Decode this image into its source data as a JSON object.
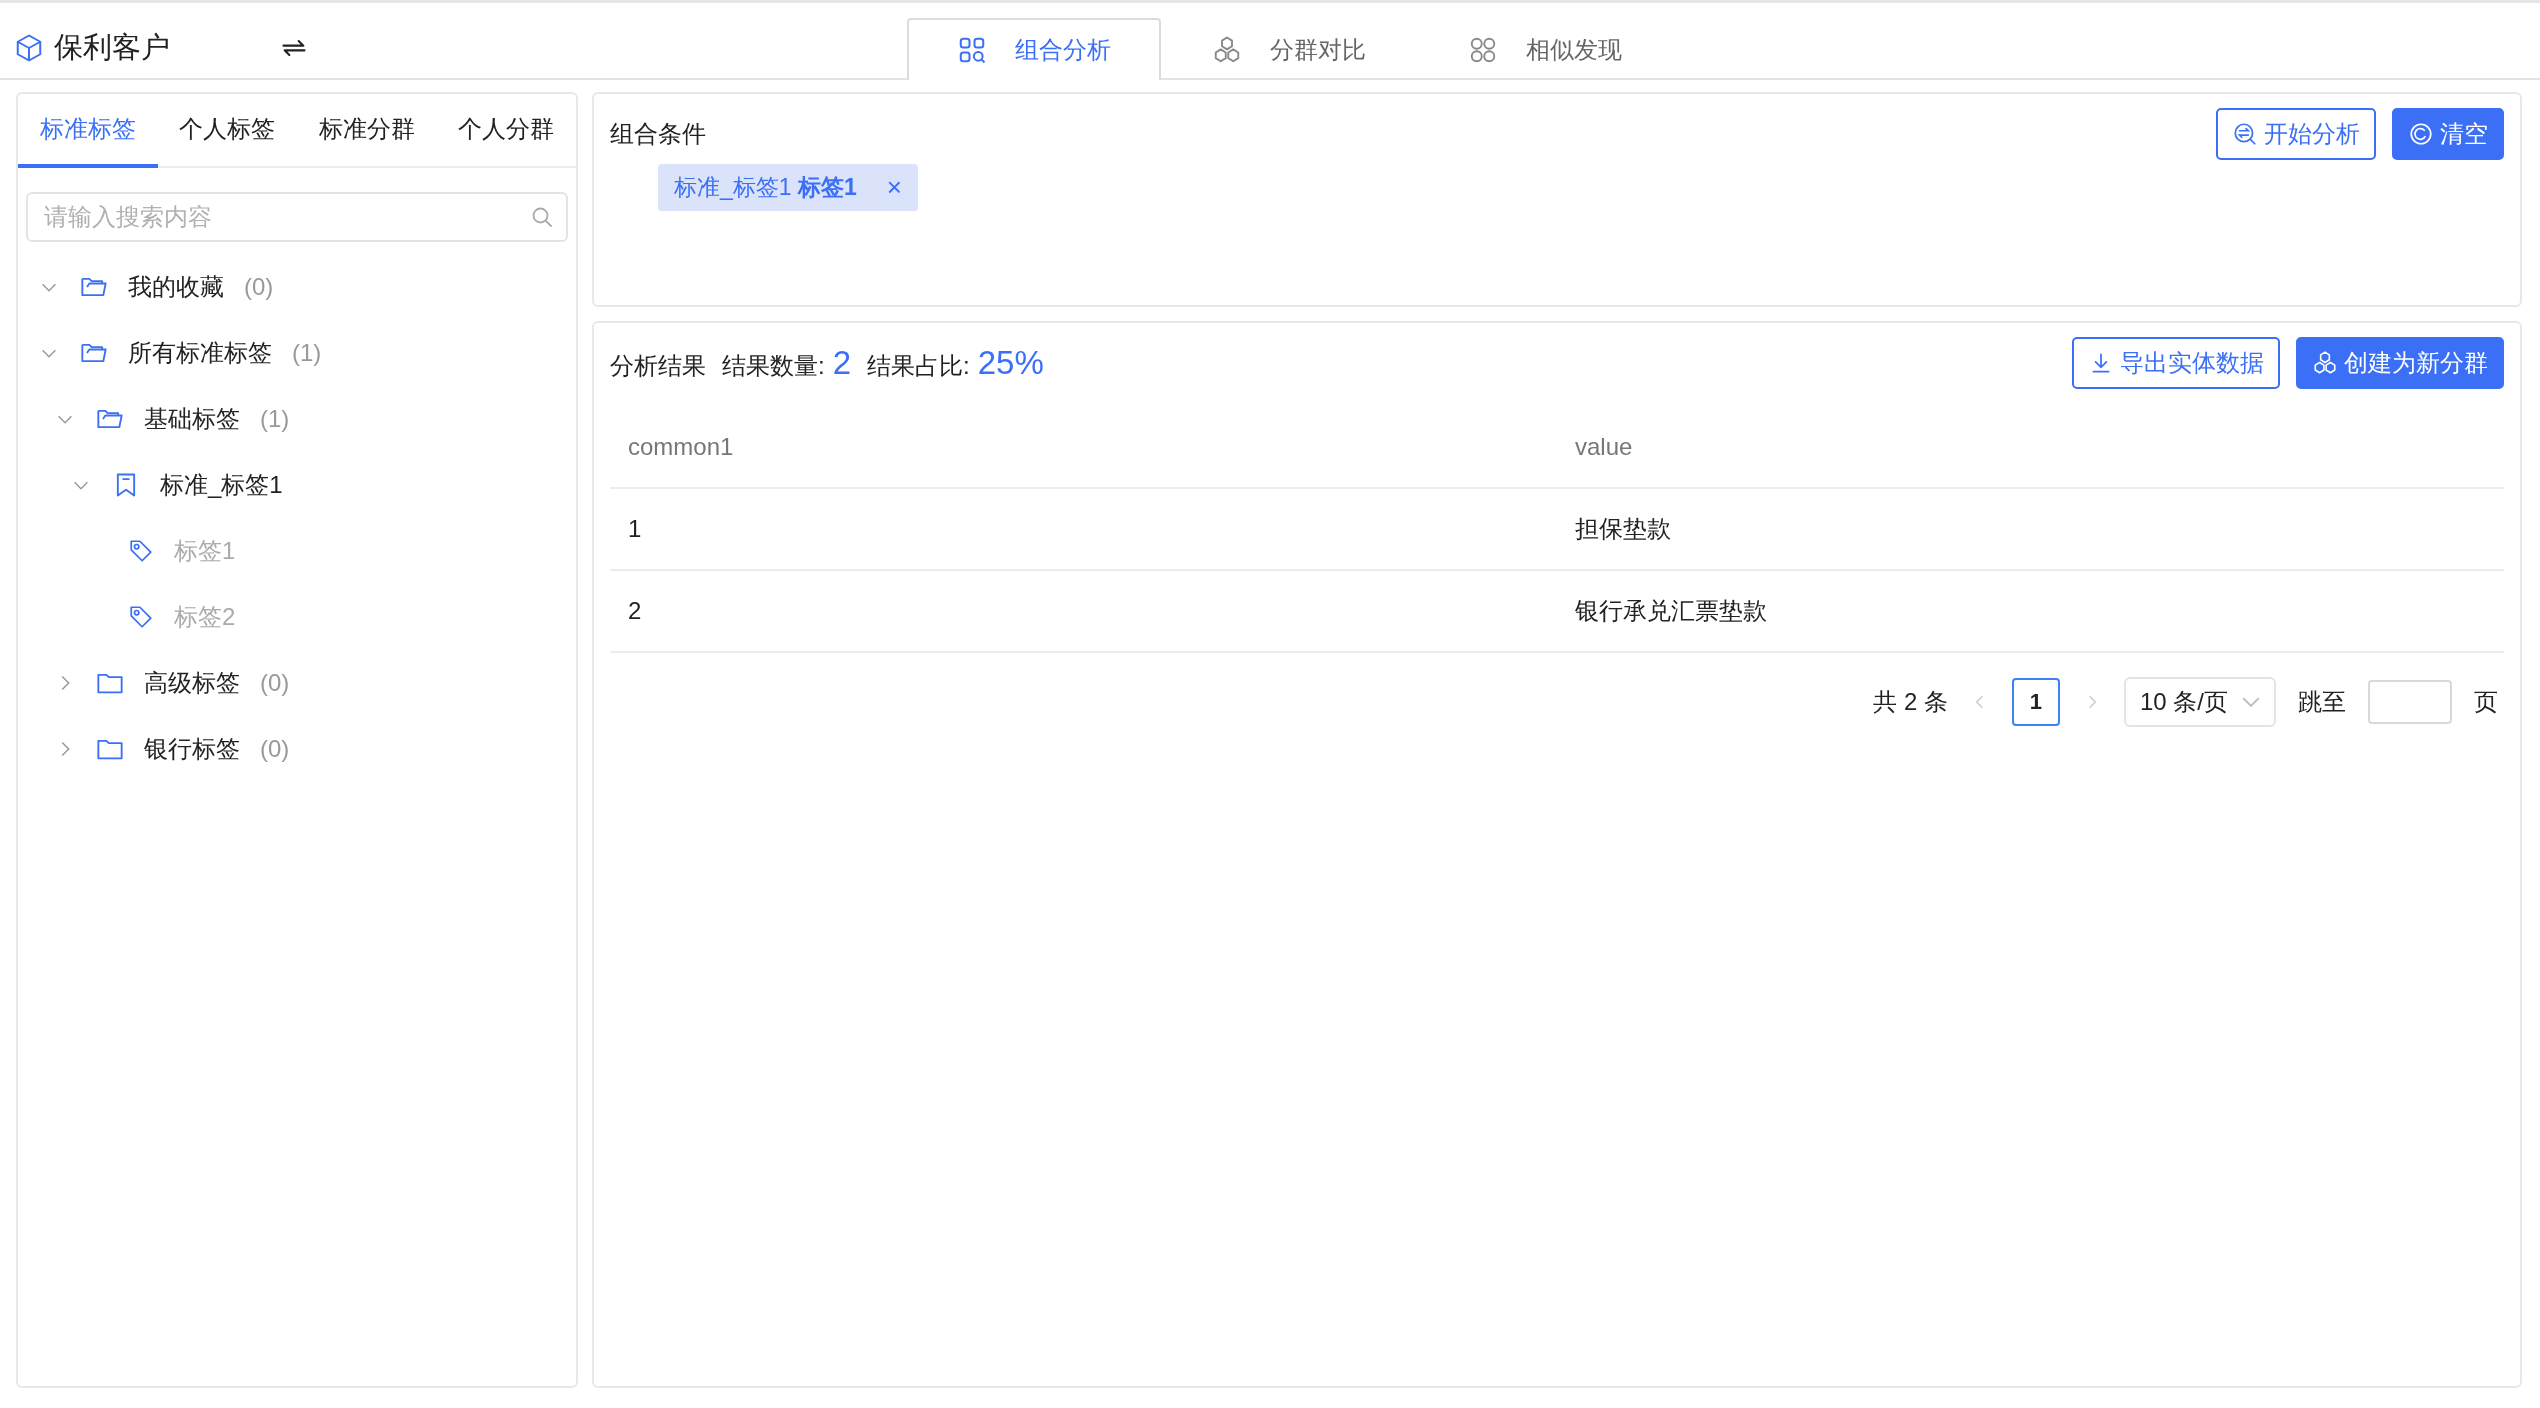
{
  "app": {
    "title": "保利客户"
  },
  "main_tabs": [
    {
      "label": "组合分析",
      "selected": true
    },
    {
      "label": "分群对比",
      "selected": false
    },
    {
      "label": "相似发现",
      "selected": false
    }
  ],
  "sidebar": {
    "tabs": [
      {
        "label": "标准标签",
        "selected": true
      },
      {
        "label": "个人标签",
        "selected": false
      },
      {
        "label": "标准分群",
        "selected": false
      },
      {
        "label": "个人分群",
        "selected": false
      }
    ],
    "search": {
      "placeholder": "请输入搜索内容"
    },
    "tree": [
      {
        "label": "我的收藏",
        "count": "(0)",
        "kind": "folder",
        "expanded": true
      },
      {
        "label": "所有标准标签",
        "count": "(1)",
        "kind": "folder",
        "expanded": true,
        "children": [
          {
            "label": "基础标签",
            "count": "(1)",
            "kind": "folder",
            "expanded": true,
            "children": [
              {
                "label": "标准_标签1",
                "kind": "bookmark",
                "expanded": true,
                "children": [
                  {
                    "label": "标签1",
                    "kind": "tag"
                  },
                  {
                    "label": "标签2",
                    "kind": "tag"
                  }
                ]
              }
            ]
          },
          {
            "label": "高级标签",
            "count": "(0)",
            "kind": "folder",
            "expanded": false
          },
          {
            "label": "银行标签",
            "count": "(0)",
            "kind": "folder",
            "expanded": false
          }
        ]
      }
    ]
  },
  "conditions": {
    "title": "组合条件",
    "buttons": [
      {
        "label": "开始分析",
        "kind": "outline"
      },
      {
        "label": "清空",
        "kind": "primary"
      }
    ],
    "chips": [
      {
        "text": "标准_标签1 **标签1**",
        "close": "×"
      }
    ]
  },
  "results": {
    "title": "分析结果",
    "count_label": "结果数量:",
    "count": "2",
    "ratio_label": "结果占比:",
    "ratio": "25%",
    "buttons": [
      {
        "label": "导出实体数据",
        "kind": "outline"
      },
      {
        "label": "创建为新分群",
        "kind": "primary"
      }
    ],
    "table": {
      "columns": [
        "common1",
        "value"
      ],
      "rows": [
        [
          "1",
          "担保垫款"
        ],
        [
          "2",
          "银行承兑汇票垫款"
        ]
      ]
    },
    "pagination": {
      "total": "共 2 条",
      "pages": [
        {
          "label": "1",
          "selected": true
        }
      ],
      "page_size": "10 条/页",
      "jump_label": "跳至",
      "page_unit": "页"
    }
  }
}
